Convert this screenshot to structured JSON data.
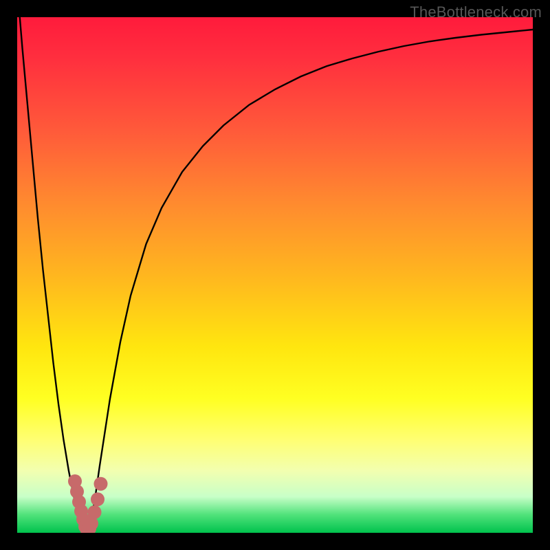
{
  "watermark": "TheBottleneck.com",
  "chart_data": {
    "type": "line",
    "title": "",
    "xlabel": "",
    "ylabel": "",
    "xlim": [
      0,
      100
    ],
    "ylim": [
      0,
      100
    ],
    "series": [
      {
        "name": "bottleneck-curve",
        "x": [
          0.5,
          1,
          2,
          3,
          4,
          5,
          6,
          7,
          8,
          9,
          10,
          11,
          12,
          13,
          13.5,
          14,
          15,
          16,
          18,
          20,
          22,
          25,
          28,
          32,
          36,
          40,
          45,
          50,
          55,
          60,
          65,
          70,
          75,
          80,
          85,
          90,
          95,
          100
        ],
        "values": [
          100,
          94,
          83,
          72,
          61,
          51,
          42,
          33,
          25,
          18,
          12,
          7,
          3,
          0.5,
          0,
          1,
          6,
          13,
          26,
          37,
          46,
          56,
          63,
          70,
          75,
          79,
          83,
          86,
          88.5,
          90.5,
          92,
          93.3,
          94.4,
          95.3,
          96,
          96.6,
          97.1,
          97.6
        ]
      }
    ],
    "markers": {
      "name": "highlight-points",
      "color": "#c76a6a",
      "radius": 10,
      "points": [
        {
          "x": 11.2,
          "y": 10.0
        },
        {
          "x": 11.6,
          "y": 8.0
        },
        {
          "x": 12.0,
          "y": 6.0
        },
        {
          "x": 12.4,
          "y": 4.2
        },
        {
          "x": 12.8,
          "y": 2.6
        },
        {
          "x": 13.2,
          "y": 1.2
        },
        {
          "x": 13.6,
          "y": 0.4
        },
        {
          "x": 14.0,
          "y": 0.8
        },
        {
          "x": 14.4,
          "y": 1.8
        },
        {
          "x": 15.0,
          "y": 4.0
        },
        {
          "x": 15.6,
          "y": 6.5
        },
        {
          "x": 16.2,
          "y": 9.5
        }
      ]
    },
    "gradient_stops": [
      {
        "y": 100,
        "color": "#ff1b3c"
      },
      {
        "y": 80,
        "color": "#ff6a35"
      },
      {
        "y": 60,
        "color": "#ffb020"
      },
      {
        "y": 40,
        "color": "#ffe610"
      },
      {
        "y": 20,
        "color": "#ffff60"
      },
      {
        "y": 5,
        "color": "#a8ffb8"
      },
      {
        "y": 0,
        "color": "#00c24d"
      }
    ]
  }
}
